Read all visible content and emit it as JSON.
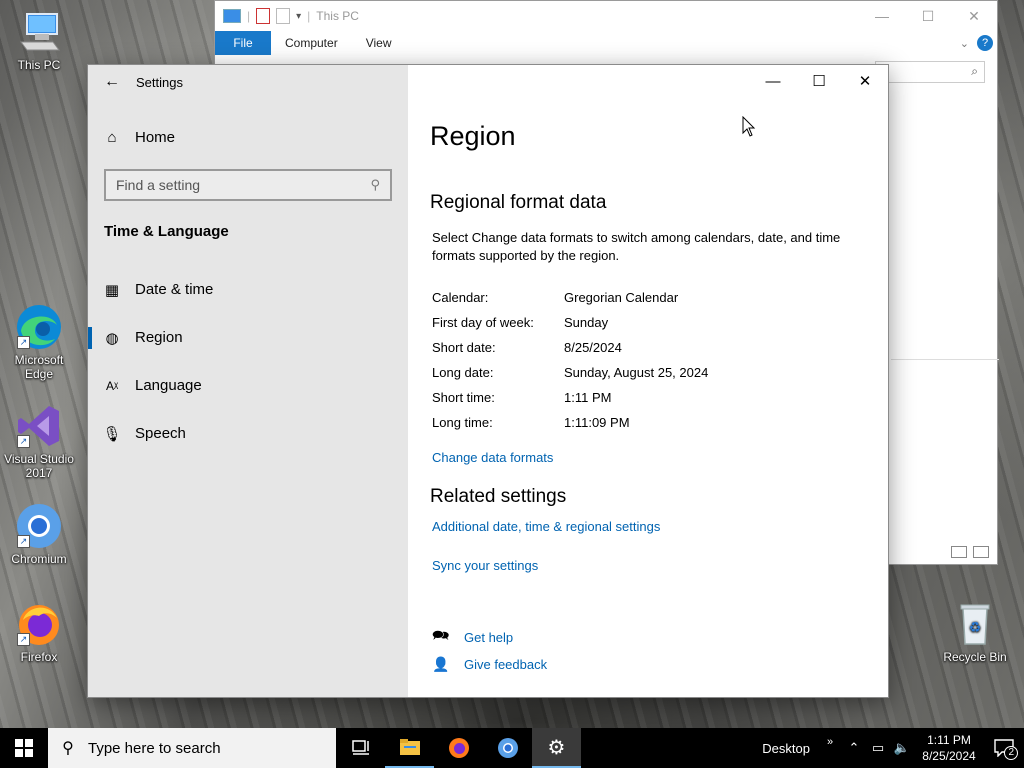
{
  "desktop": {
    "icons": [
      {
        "label": "This PC"
      },
      {
        "label": "Microsoft Edge"
      },
      {
        "label": "Visual Studio 2017"
      },
      {
        "label": "Chromium"
      },
      {
        "label": "Firefox"
      },
      {
        "label": "Recycle Bin"
      }
    ]
  },
  "explorer": {
    "title": "This PC",
    "tabs": [
      "File",
      "Computer",
      "View"
    ]
  },
  "settings": {
    "window_title": "Settings",
    "nav": {
      "home": "Home",
      "search_placeholder": "Find a setting",
      "section": "Time & Language",
      "items": [
        {
          "label": "Date & time",
          "icon": "calendar-clock-icon"
        },
        {
          "label": "Region",
          "icon": "globe-icon",
          "selected": true
        },
        {
          "label": "Language",
          "icon": "language-icon"
        },
        {
          "label": "Speech",
          "icon": "microphone-icon"
        }
      ]
    },
    "page_title": "Region",
    "regional": {
      "heading": "Regional format data",
      "description": "Select Change data formats to switch among calendars, date, and time formats supported by the region.",
      "rows": [
        {
          "k": "Calendar:",
          "v": "Gregorian Calendar"
        },
        {
          "k": "First day of week:",
          "v": "Sunday"
        },
        {
          "k": "Short date:",
          "v": "8/25/2024"
        },
        {
          "k": "Long date:",
          "v": "Sunday, August 25, 2024"
        },
        {
          "k": "Short time:",
          "v": "1:11 PM"
        },
        {
          "k": "Long time:",
          "v": "1:11:09 PM"
        }
      ],
      "change_link": "Change data formats"
    },
    "related": {
      "heading": "Related settings",
      "links": [
        "Additional date, time & regional settings",
        "Sync your settings"
      ]
    },
    "help": {
      "get_help": "Get help",
      "give_feedback": "Give feedback"
    }
  },
  "taskbar": {
    "search_placeholder": "Type here to search",
    "desktop_label": "Desktop",
    "time": "1:11 PM",
    "date": "8/25/2024",
    "notifications": "2"
  },
  "colors": {
    "accent": "#0063b1",
    "nav_bg": "#e6e6e6",
    "taskbar": "#000000"
  }
}
